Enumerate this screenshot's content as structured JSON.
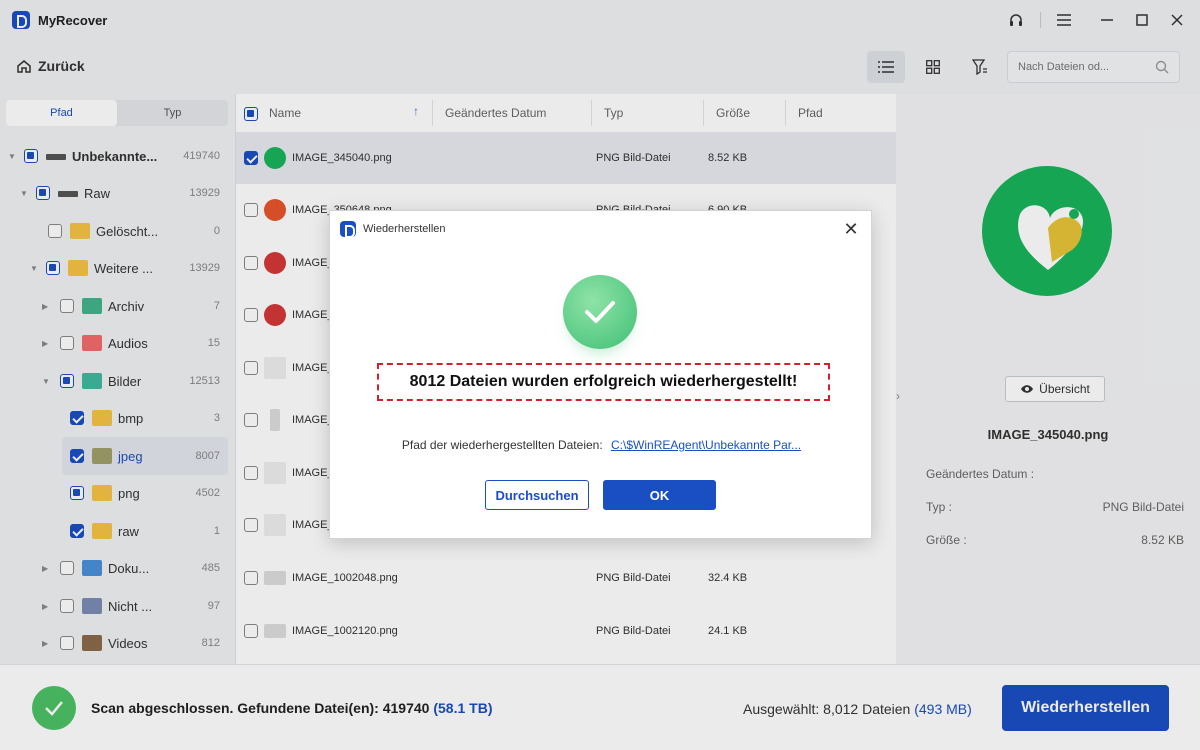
{
  "app": {
    "title": "MyRecover"
  },
  "toolbar": {
    "back_label": "Zurück",
    "search_placeholder": "Nach Dateien od..."
  },
  "sidebar": {
    "tabs": [
      {
        "label": "Pfad",
        "active": true
      },
      {
        "label": "Typ",
        "active": false
      }
    ],
    "tree": [
      {
        "label": "Unbekannte...",
        "count": "419740",
        "bold": true,
        "icon": "drive-icon",
        "state": "partial",
        "expanded": true
      },
      {
        "label": "Raw",
        "count": "13929",
        "icon": "drive-icon",
        "state": "partial",
        "expanded": true
      },
      {
        "label": "Gelöscht...",
        "count": "0",
        "icon": "trash-folder-icon",
        "state": "unchecked"
      },
      {
        "label": "Weitere ...",
        "count": "13929",
        "icon": "folder-icon",
        "state": "partial",
        "expanded": true
      },
      {
        "label": "Archiv",
        "count": "7",
        "icon": "archive-icon",
        "state": "unchecked"
      },
      {
        "label": "Audios",
        "count": "15",
        "icon": "audio-icon",
        "state": "unchecked"
      },
      {
        "label": "Bilder",
        "count": "12513",
        "icon": "image-icon",
        "state": "partial",
        "expanded": true
      },
      {
        "label": "bmp",
        "count": "3",
        "icon": "folder-icon",
        "state": "checked"
      },
      {
        "label": "jpeg",
        "count": "8007",
        "icon": "folder-icon",
        "state": "checked",
        "selected": true
      },
      {
        "label": "png",
        "count": "4502",
        "icon": "folder-icon",
        "state": "partial"
      },
      {
        "label": "raw",
        "count": "1",
        "icon": "folder-icon",
        "state": "checked"
      },
      {
        "label": "Doku...",
        "count": "485",
        "icon": "document-icon",
        "state": "unchecked"
      },
      {
        "label": "Nicht ...",
        "count": "97",
        "icon": "unknown-file-icon",
        "state": "unchecked"
      },
      {
        "label": "Videos",
        "count": "812",
        "icon": "video-icon",
        "state": "unchecked"
      }
    ]
  },
  "filelist": {
    "columns": [
      "Name",
      "Geändertes Datum",
      "Typ",
      "Größe",
      "Pfad"
    ],
    "rows": [
      {
        "name": "IMAGE_345040.png",
        "type": "PNG Bild-Datei",
        "size": "8.52 KB",
        "checked": true,
        "selected": true
      },
      {
        "name": "IMAGE_350648.png",
        "type": "PNG Bild-Datei",
        "size": "6.90 KB",
        "checked": false
      },
      {
        "name": "IMAGE_...",
        "type": "",
        "size": "",
        "checked": false
      },
      {
        "name": "IMAGE_...",
        "type": "",
        "size": "",
        "checked": false
      },
      {
        "name": "IMAGE_...",
        "type": "",
        "size": "",
        "checked": false
      },
      {
        "name": "IMAGE_...",
        "type": "",
        "size": "",
        "checked": false
      },
      {
        "name": "IMAGE_...",
        "type": "",
        "size": "",
        "checked": false
      },
      {
        "name": "IMAGE_...",
        "type": "",
        "size": "",
        "checked": false
      },
      {
        "name": "IMAGE_1002048.png",
        "type": "PNG Bild-Datei",
        "size": "32.4 KB",
        "checked": false
      },
      {
        "name": "IMAGE_1002120.png",
        "type": "PNG Bild-Datei",
        "size": "24.1 KB",
        "checked": false
      }
    ]
  },
  "preview": {
    "overview_label": "Übersicht",
    "filename": "IMAGE_345040.png",
    "props": [
      {
        "label": "Geändertes Datum :",
        "value": ""
      },
      {
        "label": "Typ :",
        "value": "PNG Bild-Datei"
      },
      {
        "label": "Größe :",
        "value": "8.52 KB"
      }
    ]
  },
  "status": {
    "text": "Scan abgeschlossen. Gefundene Datei(en): 419740",
    "size": "(58.1 TB)",
    "selected_text": "Ausgewählt: 8,012 Dateien",
    "selected_size": "(493 MB)",
    "restore_label": "Wiederherstellen"
  },
  "dialog": {
    "title": "Wiederherstellen",
    "message": "8012 Dateien wurden erfolgreich wiederhergestellt!",
    "path_label": "Pfad der wiederhergestellten Dateien:",
    "path_link": "C:\\$WinREAgent\\Unbekannte Par...",
    "browse_label": "Durchsuchen",
    "ok_label": "OK"
  },
  "colors": {
    "accent": "#1a4fc4",
    "success": "#4cc267",
    "highlight_border": "#d3202a"
  }
}
